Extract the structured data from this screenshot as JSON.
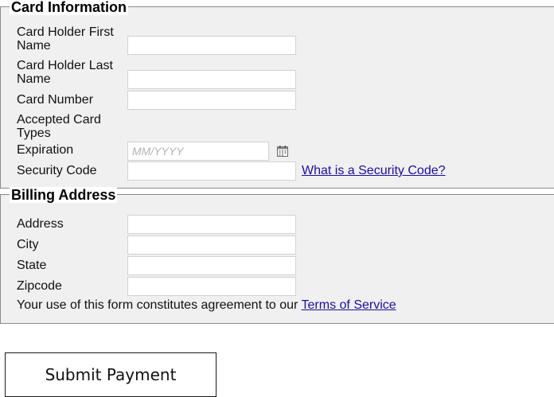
{
  "card_section": {
    "legend": "Card Information",
    "first_name_label": "Card Holder First Name",
    "last_name_label": "Card Holder Last Name",
    "card_number_label": "Card Number",
    "accepted_types_label": "Accepted Card Types",
    "expiration_label": "Expiration",
    "expiration_placeholder": "MM/YYYY",
    "security_code_label": "Security Code",
    "security_code_link": "What is a Security Code?"
  },
  "billing_section": {
    "legend": "Billing Address",
    "address_label": "Address",
    "city_label": "City",
    "state_label": "State",
    "zipcode_label": "Zipcode",
    "terms_text": "Your use of this form constitutes agreement to our ",
    "terms_link": "Terms of Service"
  },
  "submit_label": "Submit Payment",
  "icons": {
    "expiration_picker": "calendar-icon"
  },
  "colors": {
    "link": "#1a0dab",
    "panel_bg": "#f0f0f0",
    "field_border": "#d2d2d2"
  }
}
